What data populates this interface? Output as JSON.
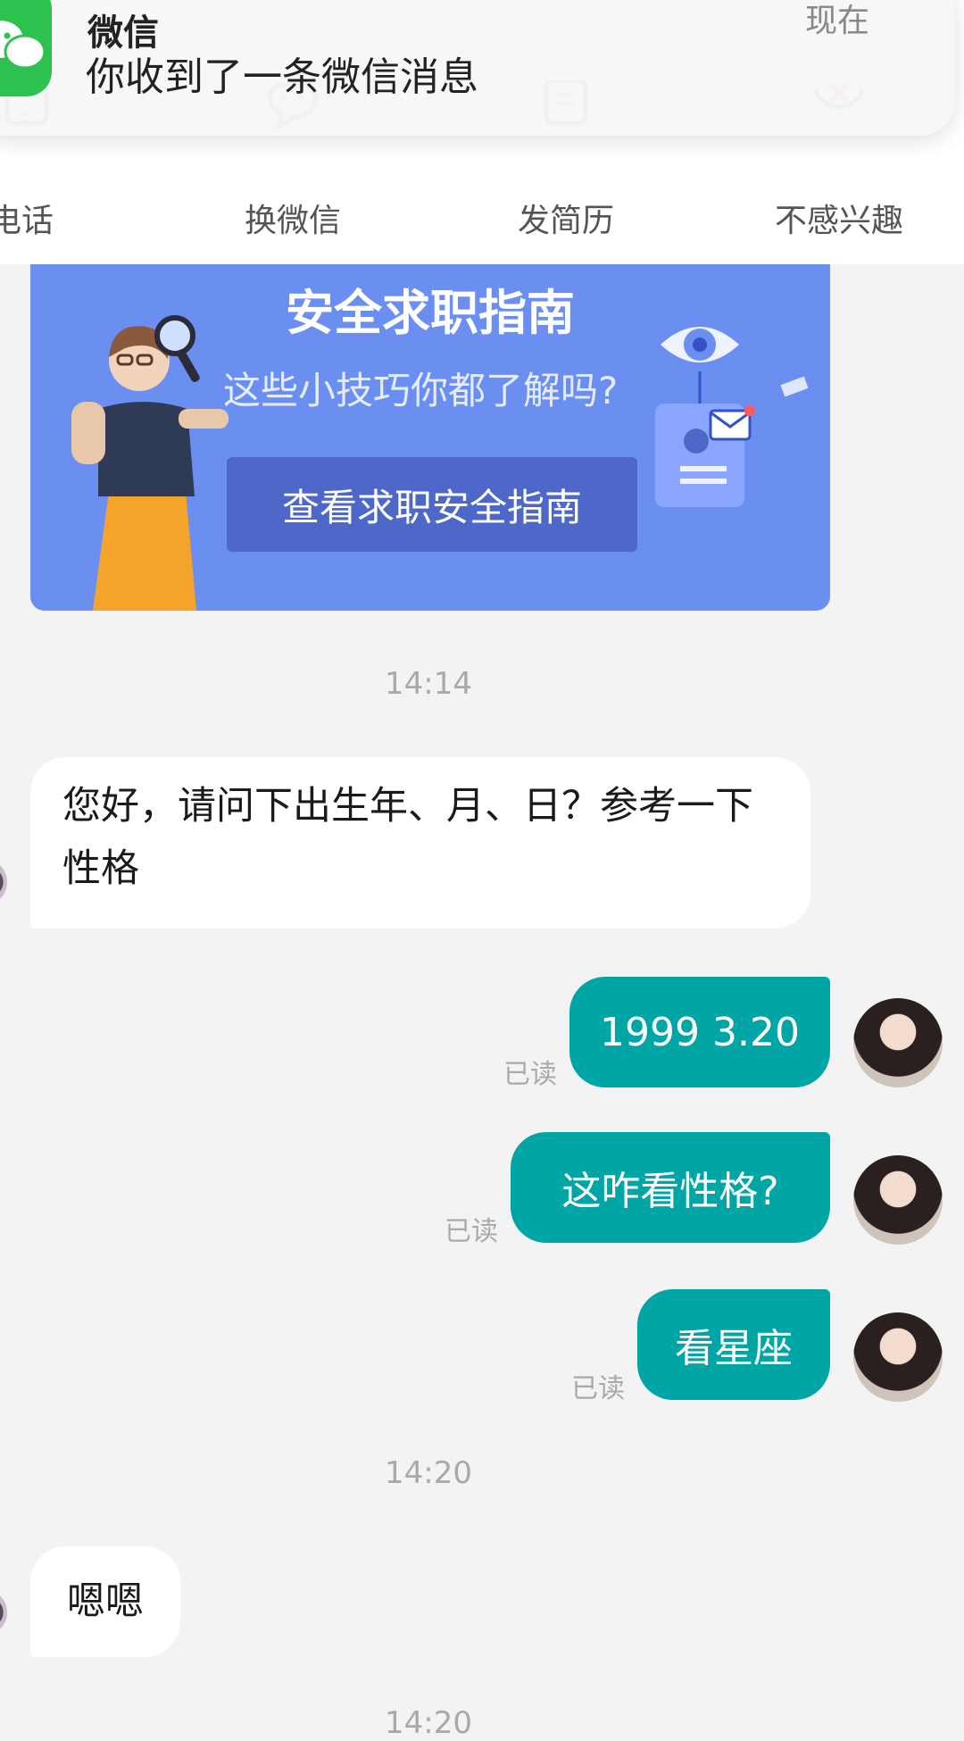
{
  "notification": {
    "app_name": "微信",
    "message": "你收到了一条微信消息",
    "time": "现在"
  },
  "actions": [
    {
      "label": "换电话",
      "visible_label": "电话",
      "icon": "phone-icon"
    },
    {
      "label": "换微信",
      "icon": "wechat-bubble-icon"
    },
    {
      "label": "发简历",
      "icon": "resume-icon"
    },
    {
      "label": "不感兴趣",
      "icon": "close-circle-icon"
    }
  ],
  "safety_card": {
    "title": "安全求职指南",
    "subtitle": "这些小技巧你都了解吗?",
    "button_label": "查看求职安全指南"
  },
  "colors": {
    "card_bg": "#6b8ef1",
    "button_bg": "#4e68c9",
    "outgoing_bubble": "#00a6a5",
    "page_bg": "#f3f3f3"
  },
  "messages": {
    "time_1": "14:14",
    "msg_1": "您好，请问下出生年、月、日？参考一下性格",
    "msg_2": "1999 3.20",
    "msg_3": "这咋看性格?",
    "msg_4": "看星座",
    "read_status": "已读",
    "time_2": "14:20",
    "msg_5": "嗯嗯",
    "time_3": "14:20"
  }
}
